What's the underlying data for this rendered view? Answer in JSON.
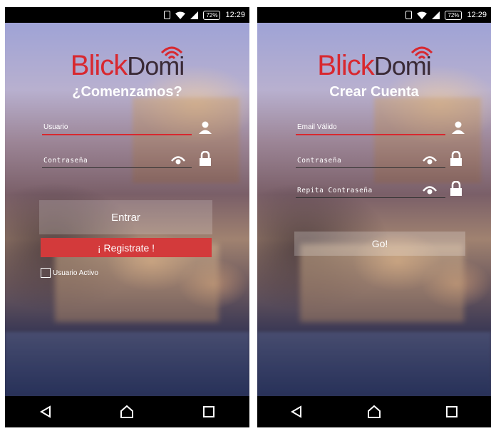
{
  "status_bar": {
    "left_phone": {
      "battery": "72%",
      "time": "12:29"
    },
    "right_phone": {
      "battery": "72%",
      "time": "12:29"
    }
  },
  "logo": {
    "part1": "Blick",
    "part2": "Domi"
  },
  "login_screen": {
    "title": "¿Comenzamos?",
    "username_label": "Usuario",
    "password_label": "Contraseña",
    "login_button": "Entrar",
    "register_button": "¡ Registrate !",
    "remember_label": "Usuario Activo",
    "remember_checked": false
  },
  "register_screen": {
    "title": "Crear Cuenta",
    "email_label": "Email Válido",
    "password_label": "Contraseña",
    "repeat_password_label": "Repita Contraseña",
    "submit_button": "Go!"
  },
  "colors": {
    "accent_red": "#d8282f",
    "button_red": "#d33a3b",
    "logo_dark": "#3a2a36"
  },
  "icons": [
    "vibrate-icon",
    "wifi-icon",
    "signal-icon",
    "battery-icon",
    "user-icon",
    "eye-icon",
    "lock-icon",
    "back-icon",
    "home-icon",
    "recents-icon"
  ]
}
